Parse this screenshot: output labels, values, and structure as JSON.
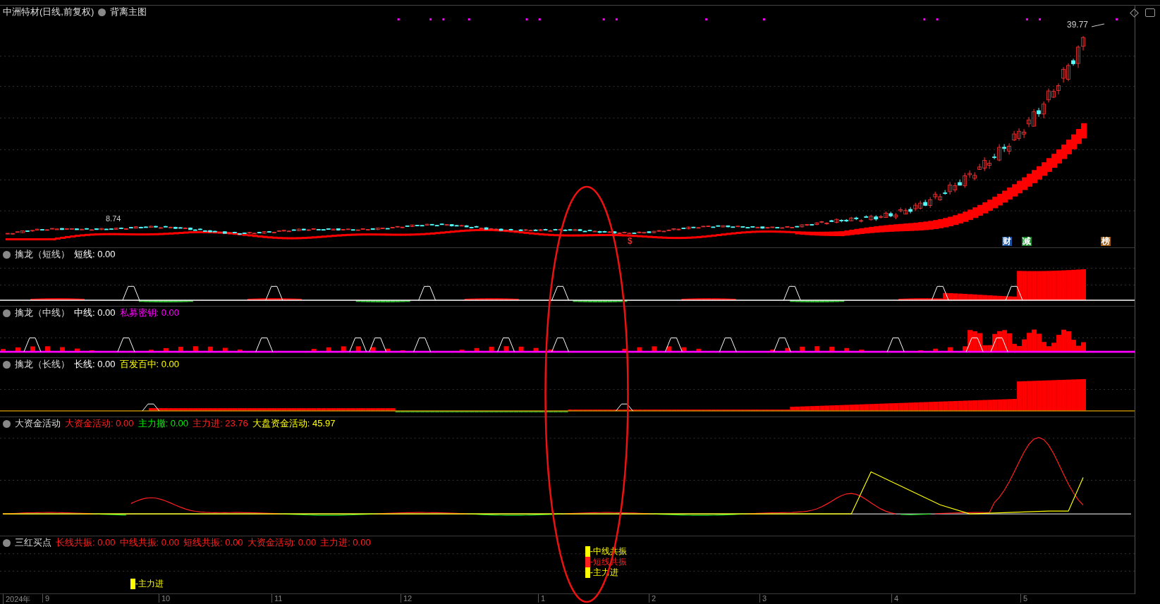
{
  "main": {
    "title": "中洲特材(日线,前复权)",
    "indicator": "背离主图",
    "high_label": "39.77",
    "low_label": "8.74",
    "markers": [
      {
        "text": "$",
        "color": "#ff2020",
        "kind": "plain"
      },
      {
        "text": "财",
        "color": "#1a4fa0",
        "kind": "tag"
      },
      {
        "text": "减",
        "color": "#1a8a2a",
        "kind": "tag"
      },
      {
        "text": "榜",
        "color": "#a05a10",
        "kind": "tag"
      }
    ]
  },
  "panels": [
    {
      "kind": "short",
      "title": "擒龙（短线）",
      "values": [
        {
          "label": "短线:",
          "value": "0.00",
          "color": "#ffffff"
        }
      ]
    },
    {
      "kind": "mid",
      "title": "擒龙（中线）",
      "values": [
        {
          "label": "中线:",
          "value": "0.00",
          "color": "#ffffff"
        },
        {
          "label": "私募密钥:",
          "value": "0.00",
          "color": "#ff00ff"
        }
      ]
    },
    {
      "kind": "long",
      "title": "擒龙（长线）",
      "values": [
        {
          "label": "长线:",
          "value": "0.00",
          "color": "#ffffff"
        },
        {
          "label": "百发百中:",
          "value": "0.00",
          "color": "#ffff00"
        }
      ]
    },
    {
      "kind": "line",
      "title": "大资金活动",
      "values": [
        {
          "label": "大资金活动:",
          "value": "0.00",
          "color": "#ff2020"
        },
        {
          "label": "主力撤:",
          "value": "0.00",
          "color": "#00ee00"
        },
        {
          "label": "主力进:",
          "value": "23.76",
          "color": "#ff2020"
        },
        {
          "label": "大盘资金活动:",
          "value": "45.97",
          "color": "#ffff00"
        }
      ]
    },
    {
      "kind": "signals",
      "title": "三红买点",
      "values": [
        {
          "label": "长线共振:",
          "value": "0.00",
          "color": "#ff2020"
        },
        {
          "label": "中线共振:",
          "value": "0.00",
          "color": "#ff2020"
        },
        {
          "label": "短线共振:",
          "value": "0.00",
          "color": "#ff2020"
        },
        {
          "label": "大资金活动:",
          "value": "0.00",
          "color": "#ff2020"
        },
        {
          "label": "主力进:",
          "value": "0.00",
          "color": "#ff2020"
        }
      ],
      "signal_groups": [
        [
          {
            "label": "-主力进",
            "color": "#ffff00"
          }
        ],
        [
          {
            "label": "-中线共振",
            "color": "#ffff00"
          },
          {
            "label": "-短线共振",
            "color": "#ff2020"
          },
          {
            "label": "-主力进",
            "color": "#ffff00"
          }
        ]
      ]
    }
  ],
  "axis": [
    "2024年",
    "9",
    "10",
    "11",
    "12",
    "1",
    "2",
    "3",
    "4",
    "5"
  ]
}
